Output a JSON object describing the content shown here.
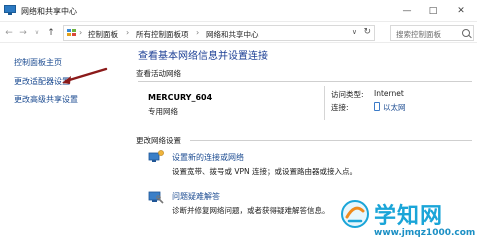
{
  "window": {
    "title": "网络和共享中心",
    "minimize_glyph": "—",
    "maximize_glyph": "□",
    "close_glyph": "✕"
  },
  "address": {
    "back_glyph": "←",
    "forward_glyph": "→",
    "recent_glyph": "∨",
    "up_glyph": "↑",
    "breadcrumbs": [
      "控制面板",
      "所有控制面板项",
      "网络和共享中心"
    ],
    "separator": "›",
    "dropdown_glyph": "∨",
    "refresh_glyph": "↻",
    "search_placeholder": "搜索控制面板"
  },
  "sidebar": {
    "items": [
      {
        "label": "控制面板主页"
      },
      {
        "label": "更改适配器设置"
      },
      {
        "label": "更改高级共享设置"
      }
    ]
  },
  "main": {
    "heading": "查看基本网络信息并设置连接",
    "active_networks_label": "查看活动网络",
    "network": {
      "name": "MERCURY_604",
      "type": "专用网络",
      "access_type_label": "访问类型:",
      "access_type_value": "Internet",
      "connections_label": "连接:",
      "connection_value": "以太网"
    },
    "change_settings_label": "更改网络设置",
    "tasks": [
      {
        "icon": "new-connection-icon",
        "link": "设置新的连接或网络",
        "desc": "设置宽带、拨号或 VPN 连接；或设置路由器或接入点。"
      },
      {
        "icon": "troubleshoot-icon",
        "link": "问题疑难解答",
        "desc": "诊断并修复网络问题，或者获得疑难解答信息。"
      }
    ]
  },
  "watermark": {
    "text": "学知网",
    "url": "www.jmqz1000.com"
  },
  "colors": {
    "link": "#1b4b91",
    "heading": "#1c3f95",
    "arrow": "#8b1a1a",
    "watermark": "#1aa5d8"
  }
}
